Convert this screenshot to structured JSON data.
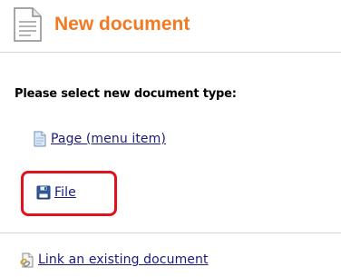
{
  "header": {
    "title": "New document",
    "icon": "document-icon"
  },
  "prompt": "Please select new document type:",
  "items": [
    {
      "label": "Page (menu item)",
      "icon": "page-icon"
    },
    {
      "label": "File",
      "icon": "floppy-disk-icon",
      "highlighted": true
    },
    {
      "label": "Link an existing document",
      "icon": "link-document-icon"
    }
  ],
  "colors": {
    "title": "#f27a20",
    "link": "#1a1a7a",
    "highlight": "#e0121d",
    "divider": "#d4d4d4"
  }
}
